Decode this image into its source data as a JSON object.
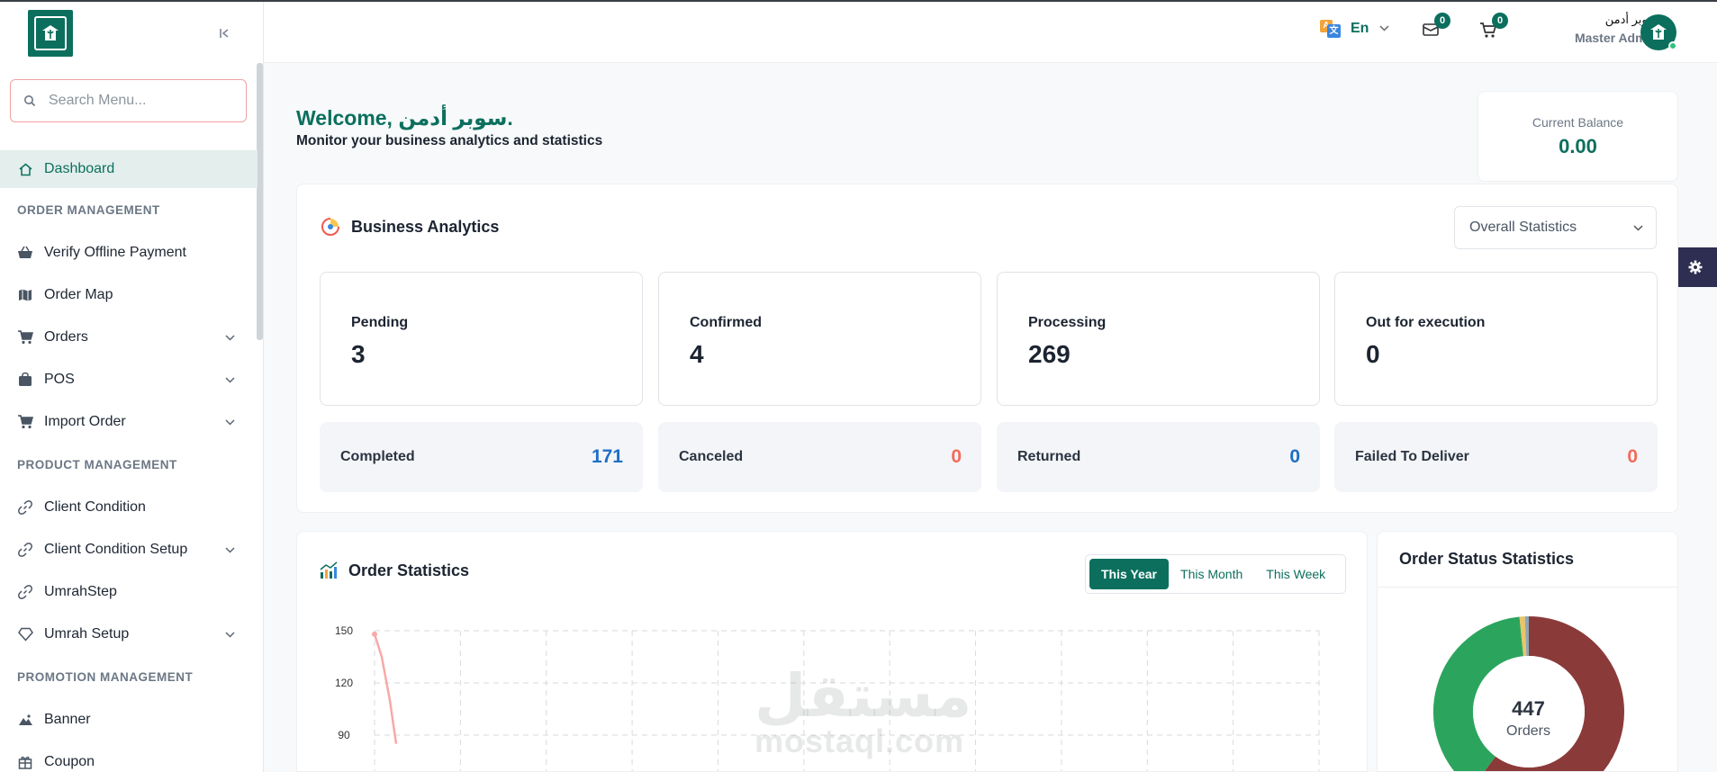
{
  "sidebar": {
    "search_placeholder": "Search Menu...",
    "items": [
      {
        "label": "Dashboard",
        "icon": "home-icon"
      },
      {
        "section": "ORDER MANAGEMENT"
      },
      {
        "label": "Verify Offline Payment",
        "icon": "basket-icon"
      },
      {
        "label": "Order Map",
        "icon": "map-icon"
      },
      {
        "label": "Orders",
        "icon": "cart-icon"
      },
      {
        "label": "POS",
        "icon": "bag-icon"
      },
      {
        "label": "Import Order",
        "icon": "cart-icon"
      },
      {
        "section": "PRODUCT MANAGEMENT"
      },
      {
        "label": "Client Condition",
        "icon": "link-icon"
      },
      {
        "label": "Client Condition Setup",
        "icon": "link-icon"
      },
      {
        "label": "UmrahStep",
        "icon": "link-icon"
      },
      {
        "label": "Umrah Setup",
        "icon": "diamond-icon"
      },
      {
        "section": "PROMOTION MANAGEMENT"
      },
      {
        "label": "Banner",
        "icon": "image-icon"
      },
      {
        "label": "Coupon",
        "icon": "gift-icon"
      }
    ]
  },
  "topbar": {
    "language": "En",
    "messages_count": "0",
    "cart_count": "0",
    "user_name": "سوبر أدمن",
    "user_role": "Master Admin"
  },
  "welcome": {
    "title": "Welcome, سوبر أدمن.",
    "subtitle": "Monitor your business analytics and statistics"
  },
  "balance": {
    "label": "Current Balance",
    "value": "0.00"
  },
  "analytics": {
    "title": "Business Analytics",
    "filter": "Overall Statistics",
    "stats": [
      {
        "label": "Pending",
        "value": "3"
      },
      {
        "label": "Confirmed",
        "value": "4"
      },
      {
        "label": "Processing",
        "value": "269"
      },
      {
        "label": "Out for execution",
        "value": "0"
      }
    ],
    "mini": [
      {
        "label": "Completed",
        "value": "171",
        "color": "#1f6fc5"
      },
      {
        "label": "Canceled",
        "value": "0",
        "color": "#f26b5b"
      },
      {
        "label": "Returned",
        "value": "0",
        "color": "#1f6fc5"
      },
      {
        "label": "Failed To Deliver",
        "value": "0",
        "color": "#f26b5b"
      }
    ]
  },
  "order_statistics": {
    "title": "Order Statistics",
    "tabs": [
      "This Year",
      "This Month",
      "This Week"
    ],
    "active_tab": "This Year"
  },
  "order_status": {
    "title": "Order Status Statistics",
    "total": "447",
    "total_label": "Orders"
  },
  "watermark": {
    "ar": "مستقل",
    "en": "mostaql.com"
  },
  "chart_data": [
    {
      "type": "line",
      "title": "Order Statistics",
      "y_ticks": [
        150,
        120,
        90
      ],
      "ylim": [
        90,
        150
      ],
      "series": [
        {
          "values": [
            148,
            135,
            110,
            85
          ],
          "color": "#f7a9a6"
        }
      ],
      "grid": true
    },
    {
      "type": "pie",
      "title": "Order Status Statistics",
      "slices": [
        {
          "value": 269,
          "color": "#8b3a3a"
        },
        {
          "value": 171,
          "color": "#2ba55d"
        },
        {
          "value": 4,
          "color": "#e9c46a"
        },
        {
          "value": 3,
          "color": "#8fa6b2"
        }
      ]
    }
  ],
  "colors": {
    "brand": "#0c6f5e",
    "accent_blue": "#1f6fc5",
    "accent_red": "#f26b5b"
  }
}
